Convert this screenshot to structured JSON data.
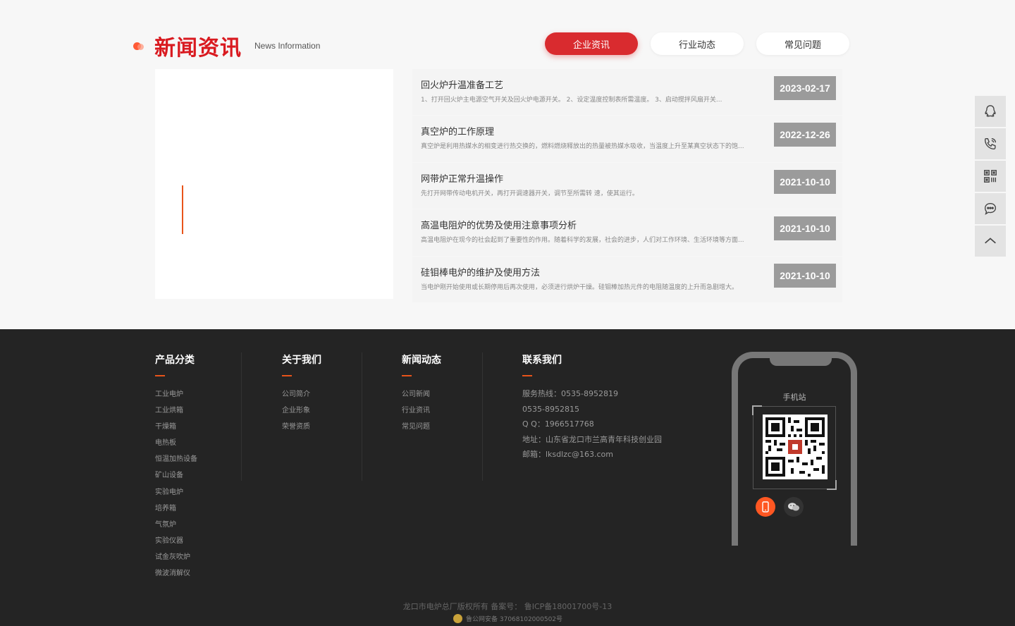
{
  "news": {
    "title": "新闻资讯",
    "subtitle": "News Information",
    "tabs": [
      {
        "label": "企业资讯",
        "active": true
      },
      {
        "label": "行业动态",
        "active": false
      },
      {
        "label": "常见问题",
        "active": false
      }
    ],
    "items": [
      {
        "title": "回火炉升温准备工艺",
        "desc": "1、打开回火炉主电源空气开关及回火炉电源开关。 2、设定温度控制表所需温度。 3、启动搅拌风扇开关...",
        "date": "2023-02-17"
      },
      {
        "title": "真空炉的工作原理",
        "desc": "真空炉是利用热媒水的相变进行热交换的，燃料燃烧释放出的热量被热媒水吸收，当温度上升至某真空状态下的饱...",
        "date": "2022-12-26"
      },
      {
        "title": "网带炉正常升温操作",
        "desc": "先打开网带传动电机开关，再打开调速器开关，调节至所需转 速，使其运行。",
        "date": "2021-10-10"
      },
      {
        "title": "高温电阻炉的优势及使用注意事项分析",
        "desc": "高温电阻炉在现今的社会起到了重要性的作用。随着科学的发展，社会的进步，人们对工作环境、生活环境等方面...",
        "date": "2021-10-10"
      },
      {
        "title": "硅钼棒电炉的维护及使用方法",
        "desc": "当电炉刚开始使用或长期停用后再次使用，必须进行烘炉干燥。硅钼棒加热元件的电阻随温度的上升而急剧增大。",
        "date": "2021-10-10"
      }
    ]
  },
  "sidebar": {
    "icons": [
      "qq-icon",
      "phone-icon",
      "qrcode-icon",
      "chat-icon",
      "back-to-top-icon"
    ]
  },
  "footer": {
    "products": {
      "title": "产品分类",
      "items": [
        "工业电炉",
        "工业烘箱",
        "干燥箱",
        "电热板",
        "恒温加热设备",
        "矿山设备",
        "实验电炉",
        "培养箱",
        "气氛炉",
        "实验仪器",
        "试金灰吹炉",
        "微波消解仪"
      ]
    },
    "about": {
      "title": "关于我们",
      "items": [
        "公司简介",
        "企业形象",
        "荣誉资质"
      ]
    },
    "newsCol": {
      "title": "新闻动态",
      "items": [
        "公司新闻",
        "行业资讯",
        "常见问题"
      ]
    },
    "contact": {
      "title": "联系我们",
      "items": [
        "服务热线：0535-8952819",
        "0535-8952815",
        "Q Q：1966517768",
        "地址：山东省龙口市兰高青年科技创业园",
        "邮箱：lksdlzc@163.com"
      ]
    },
    "mobile": {
      "label": "手机站"
    },
    "copyright": "龙口市电炉总厂版权所有   备案号：  鲁ICP备18001700号-13",
    "police": "鲁公网安备 37068102000502号"
  },
  "colors": {
    "brand_red": "#d92b2f",
    "accent_orange": "#e8541a",
    "date_gray": "#9b9b9b",
    "footer_bg": "#242424"
  }
}
